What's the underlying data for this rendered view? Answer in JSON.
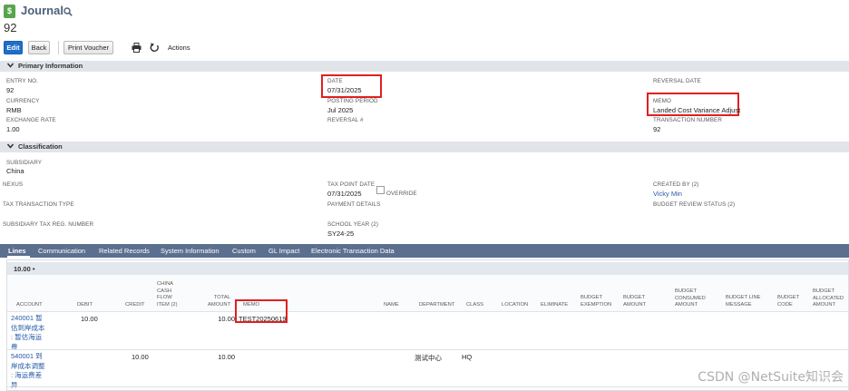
{
  "header": {
    "app_icon_glyph": "$",
    "title": "Journal",
    "record_id": "92"
  },
  "toolbar": {
    "edit_label": "Edit",
    "back_label": "Back",
    "print_voucher_label": "Print Voucher",
    "actions_label": "Actions"
  },
  "primary_info": {
    "section_label": "Primary Information",
    "entry_no_label": "ENTRY NO.",
    "entry_no_value": "92",
    "currency_label": "CURRENCY",
    "currency_value": "RMB",
    "exchange_rate_label": "EXCHANGE RATE",
    "exchange_rate_value": "1.00",
    "date_label": "DATE",
    "date_value": "07/31/2025",
    "posting_period_label": "POSTING PERIOD",
    "posting_period_value": "Jul 2025",
    "reversal_no_label": "REVERSAL #",
    "reversal_date_label": "REVERSAL DATE",
    "memo_label": "MEMO",
    "memo_value": "Landed Cost Variance Adjust",
    "transaction_number_label": "TRANSACTION NUMBER",
    "transaction_number_value": "92"
  },
  "classification": {
    "section_label": "Classification",
    "subsidiary_label": "SUBSIDIARY",
    "subsidiary_value": "China",
    "nexus_label": "NEXUS",
    "tax_transaction_type_label": "TAX TRANSACTION TYPE",
    "subsidiary_tax_reg_label": "SUBSIDIARY TAX REG. NUMBER",
    "tax_point_date_label": "TAX POINT DATE",
    "tax_point_date_value": "07/31/2025",
    "override_label": "OVERRIDE",
    "payment_details_label": "PAYMENT DETAILS",
    "school_year_label": "SCHOOL YEAR (2)",
    "school_year_value": "SY24-25",
    "created_by_label": "CREATED BY (2)",
    "created_by_value": "Vicky Min",
    "budget_review_status_label": "BUDGET REVIEW STATUS (2)"
  },
  "tabs": {
    "lines": "Lines",
    "communication": "Communication",
    "related_records": "Related Records",
    "system_information": "System Information",
    "custom": "Custom",
    "gl_impact": "GL Impact",
    "electronic_transaction_data": "Electronic Transaction Data"
  },
  "lines": {
    "subtab_label": "10.00 •",
    "columns": {
      "account": "ACCOUNT",
      "debit": "DEBIT",
      "credit": "CREDIT",
      "china_cash_flow_1": "CHINA",
      "china_cash_flow_2": "CASH",
      "china_cash_flow_3": "FLOW",
      "china_cash_flow_4": "ITEM (2)",
      "total_amount_1": "TOTAL",
      "total_amount_2": "AMOUNT",
      "memo": "MEMO",
      "name": "NAME",
      "department": "DEPARTMENT",
      "class": "CLASS",
      "location": "LOCATION",
      "eliminate": "ELIMINATE",
      "budget_exemption_1": "BUDGET",
      "budget_exemption_2": "EXEMPTION",
      "budget_amount_1": "BUDGET",
      "budget_amount_2": "AMOUNT",
      "budget_consumed_amount_1": "BUDGET",
      "budget_consumed_amount_2": "CONSUMED",
      "budget_consumed_amount_3": "AMOUNT",
      "budget_line_message_1": "BUDGET LINE",
      "budget_line_message_2": "MESSAGE",
      "budget_code_1": "BUDGET",
      "budget_code_2": "CODE",
      "budget_allocated_amount_1": "BUDGET",
      "budget_allocated_amount_2": "ALLOCATED",
      "budget_allocated_amount_3": "AMOUNT"
    },
    "rows": [
      {
        "account_line1": "240001 暂",
        "account_line2": "估到岸成本",
        "account_line3": ": 暂估海运",
        "account_line4": "费",
        "debit": "10.00",
        "credit": "",
        "total_amount": "10.00",
        "memo": "TEST20250619",
        "department": "",
        "class": ""
      },
      {
        "account_line1": "540001 到",
        "account_line2": "岸成本调整",
        "account_line3": ": 海运费差",
        "account_line4": "异",
        "debit": "",
        "credit": "10.00",
        "total_amount": "10.00",
        "memo": "",
        "department": "测试中心",
        "class": "HQ"
      }
    ]
  },
  "watermark": "CSDN @NetSuite知识会",
  "colors": {
    "brand_blue": "#1f6ec9",
    "tab_bar": "#5b6f8f",
    "highlight_red": "#e02020",
    "link_blue": "#255aa8"
  }
}
